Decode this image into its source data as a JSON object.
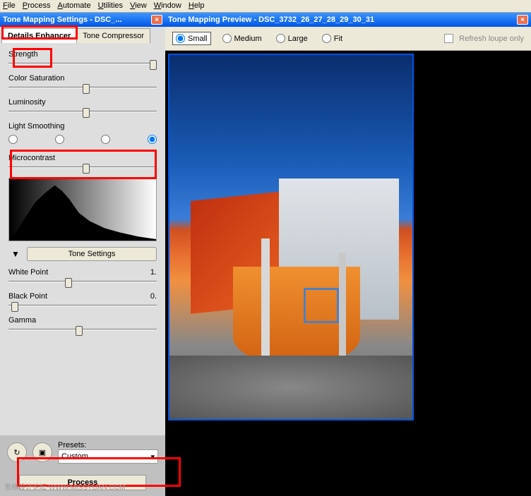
{
  "menu": {
    "file": "File",
    "process": "Process",
    "automate": "Automate",
    "utilities": "Utilities",
    "view": "View",
    "window": "Window",
    "help": "Help"
  },
  "settings": {
    "title": "Tone Mapping Settings - DSC_...",
    "tabs": {
      "enhancer": "Details Enhancer",
      "compressor": "Tone Compressor"
    },
    "sliders": {
      "strength": "Strength",
      "saturation": "Color Saturation",
      "luminosity": "Luminosity",
      "lightSmoothing": "Light Smoothing",
      "microcontrast": "Microcontrast",
      "whitePoint": {
        "label": "White Point",
        "value": "1."
      },
      "blackPoint": {
        "label": "Black Point",
        "value": "0."
      },
      "gamma": "Gamma"
    },
    "toneSettings": "Tone Settings",
    "presets": {
      "label": "Presets:",
      "value": "Custom"
    },
    "process": "Process"
  },
  "preview": {
    "title": "Tone Mapping Preview - DSC_3732_26_27_28_29_30_31",
    "sizes": {
      "small": "Small",
      "medium": "Medium",
      "large": "Large",
      "fit": "Fit"
    },
    "refresh": "Refresh loupe only"
  },
  "watermark": "思缘设计论坛  WWW.MISSYUAN.COM"
}
